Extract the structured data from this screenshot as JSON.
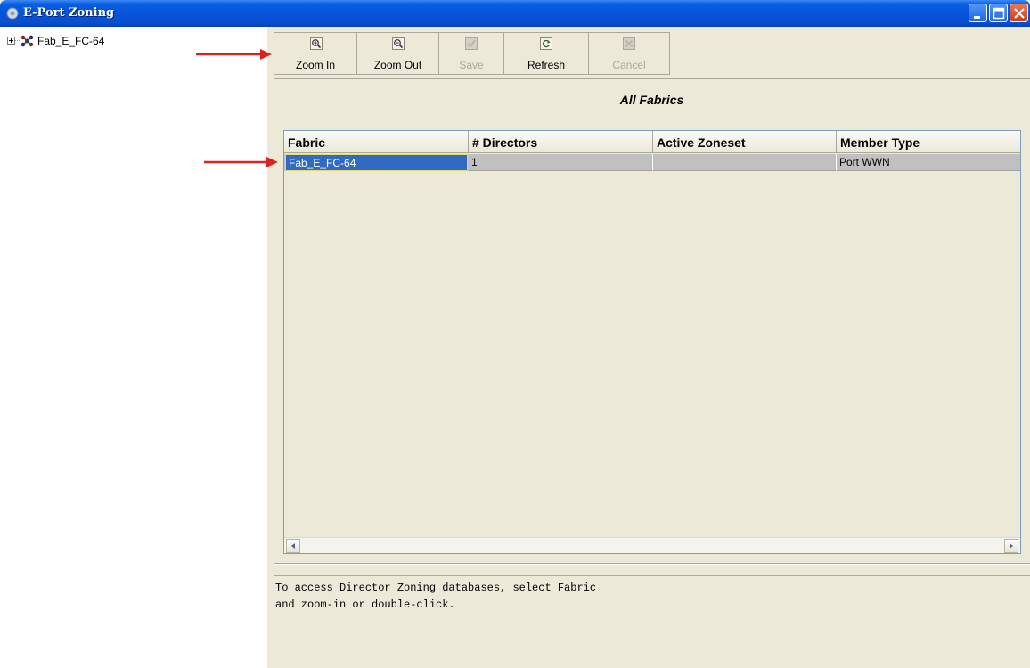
{
  "window": {
    "title": "E-Port Zoning",
    "title_bar_color": "#0553d9"
  },
  "tree": {
    "items": [
      {
        "label": "Fab_E_FC-64",
        "icon": "fabric-icon",
        "expander": "plus"
      }
    ]
  },
  "toolbar": {
    "buttons": [
      {
        "label": "Zoom In",
        "icon": "zoom-in-icon",
        "enabled": true
      },
      {
        "label": "Zoom Out",
        "icon": "zoom-out-icon",
        "enabled": true
      },
      {
        "label": "Save",
        "icon": "save-icon",
        "enabled": false
      },
      {
        "label": "Refresh",
        "icon": "refresh-icon",
        "enabled": true
      },
      {
        "label": "Cancel",
        "icon": "cancel-icon",
        "enabled": false
      }
    ]
  },
  "main": {
    "heading": "All Fabrics",
    "table": {
      "columns": [
        "Fabric",
        "# Directors",
        "Active Zoneset",
        "Member Type"
      ],
      "rows": [
        {
          "fabric": "Fab_E_FC-64",
          "directors": "1",
          "active_zoneset": "",
          "member_type": "Port WWN",
          "selected": true
        }
      ]
    },
    "message": "To access Director Zoning databases, select Fabric\nand zoom-in or double-click."
  },
  "annotations": {
    "arrow_color": "#e02020",
    "arrows": [
      "toolbar-arrow",
      "row-arrow"
    ]
  },
  "colors": {
    "selection": "#316ac5",
    "row_background": "#c0c0c0",
    "panel_background": "#ece9d8"
  }
}
